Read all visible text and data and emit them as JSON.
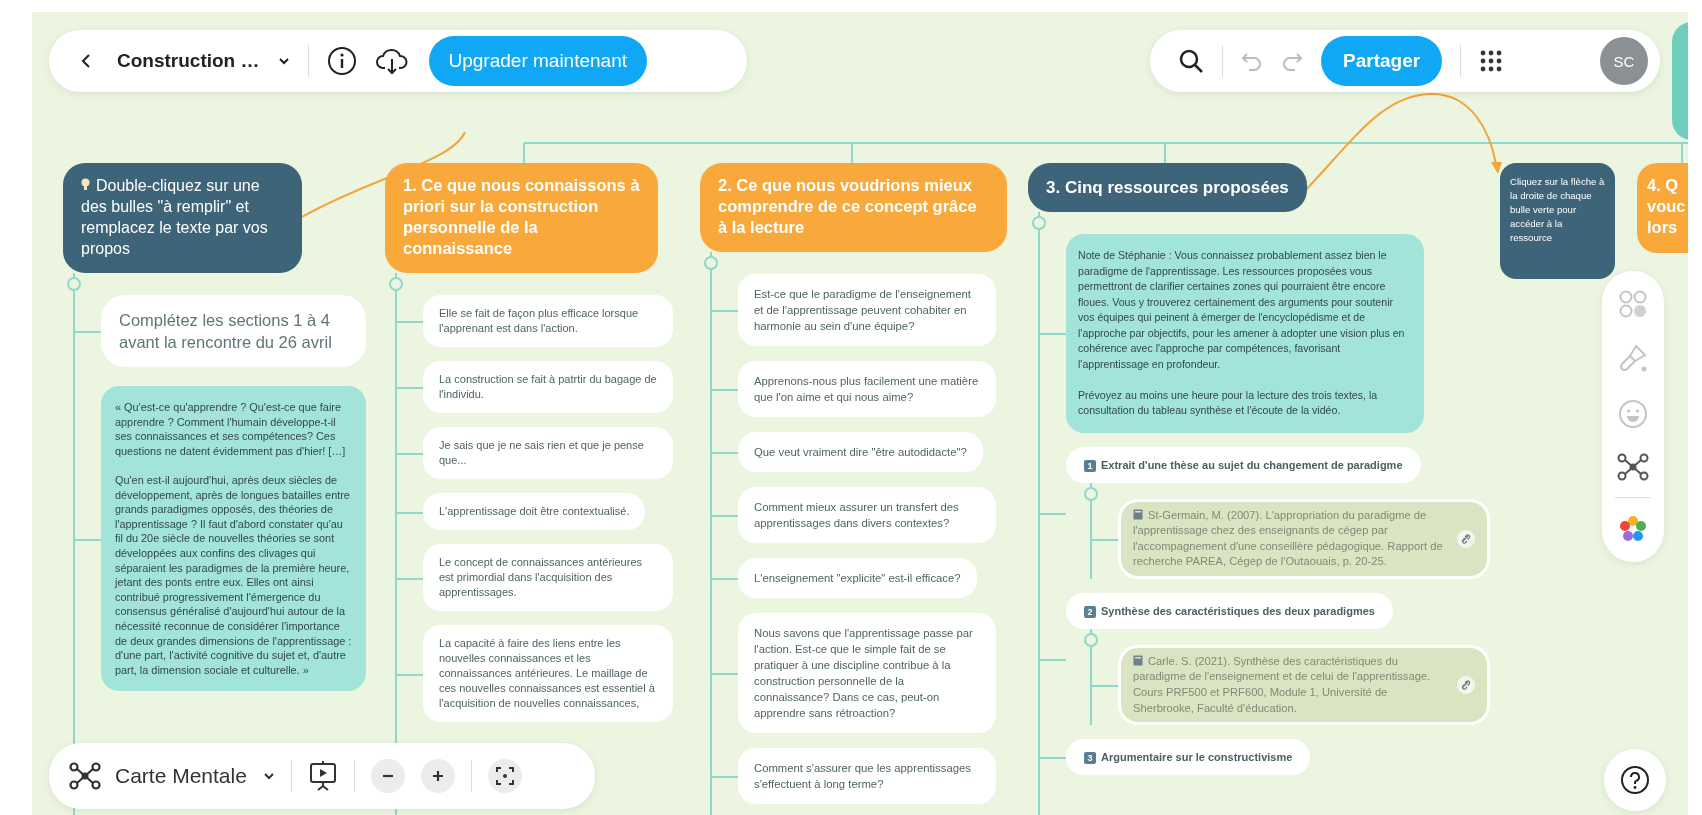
{
  "top_bar": {
    "title": "Construction …",
    "upgrade_button": "Upgrader maintenant",
    "share_button": "Partager",
    "avatar": "SC"
  },
  "columns": [
    {
      "header": {
        "text": "Double-cliquez sur une des bulles \"à remplir\" et remplacez le texte par vos propos",
        "color": "#3d6478"
      },
      "children": [
        {
          "kind": "label",
          "text": "Complétez les sections 1 à 4 avant la rencontre du 26 avril"
        },
        {
          "kind": "note",
          "text": "« Qu'est-ce qu'apprendre ? Qu'est-ce que faire apprendre ? Comment l'humain développe-t-il ses connaissances et ses compétences? Ces questions ne datent évidemment pas d'hier! […]\n\nQu'en est-il aujourd'hui, après deux siècles de développement, après de longues batailles entre grands paradigmes opposés, des théories de l'apprentissage ? Il faut d'abord constater qu'au fil du 20e siècle de nouvelles théories se sont développées aux confins des clivages qui séparaient les paradigmes de la première heure, jetant des ponts entre eux. Elles ont ainsi contribué progressivement l'émergence du consensus généralisé d'aujourd'hui autour de la nécessité reconnue de considérer l'importance de deux grandes dimensions de l'apprentissage : d'une part, l'activité cognitive du sujet et, d'autre part, la dimension sociale et culturelle. »"
        }
      ]
    },
    {
      "header": {
        "text": "1. Ce que nous connaissons à priori sur la construction personnelle de la connaissance",
        "color": "#f9a93b"
      },
      "children": [
        {
          "kind": "bubble",
          "text": "Elle se fait de façon plus efficace lorsque l'apprenant est dans l'action."
        },
        {
          "kind": "bubble",
          "text": "La construction se fait à patrtir du bagage de l'individu."
        },
        {
          "kind": "bubble",
          "text": "Je sais que je ne sais rien et que je pense que..."
        },
        {
          "kind": "bubble",
          "text": "L'apprentissage doit être contextualisé."
        },
        {
          "kind": "bubble",
          "text": "Le concept de connaissances antérieures est primordial dans l'acquisition des apprentissages."
        },
        {
          "kind": "bubble",
          "text": "La capacité à faire des liens entre les nouvelles connaissances et les connaissances antérieures.  Le maillage de ces nouvelles connaissances est essentiel à l'acquisition de nouvelles connaissances,"
        }
      ]
    },
    {
      "header": {
        "text": "2. Ce que nous voudrions mieux comprendre de ce concept grâce à la lecture",
        "color": "#f9a93b"
      },
      "children": [
        {
          "kind": "bubble",
          "text": "Est-ce que le paradigme de l'enseignement et de l'apprentissage peuvent cohabiter en harmonie au sein d'une équipe?"
        },
        {
          "kind": "bubble",
          "text": "Apprenons-nous plus facilement une matière que l'on aime et qui nous aime?"
        },
        {
          "kind": "bubble",
          "text": "Que veut vraiment dire \"être autodidacte\"?"
        },
        {
          "kind": "bubble",
          "text": "Comment mieux assurer un transfert des apprentissages dans divers contextes?"
        },
        {
          "kind": "bubble",
          "text": "L'enseignement \"explicite\" est-il efficace?"
        },
        {
          "kind": "bubble",
          "text": "Nous savons que l'apprentissage passe par l'action. Est-ce que le simple fait de se pratiquer à une discipline contribue à la construction personnelle de la connaissance?  Dans ce cas, peut-on apprendre sans rétroaction?"
        },
        {
          "kind": "bubble",
          "text": "Comment s'assurer que les apprentissages s'effectuent à long terme?"
        }
      ]
    },
    {
      "header": {
        "text": "3. Cinq ressources proposées",
        "color": "#3d6478"
      },
      "children": [
        {
          "kind": "note",
          "text": "Note de Stéphanie : Vous connaissez probablement assez bien le paradigme de l'apprentissage. Les ressources proposées vous permettront de clarifier certaines zones qui pourraient être encore floues. Vous y trouverez certainement des arguments pour soutenir vos équipes qui peinent à émerger de l'encyclopédisme et de l'approche par objectifs, pour les amener à adopter une vision plus en cohérence avec l'approche par compétences, favorisant l'apprentissage en profondeur.\n\nPrévoyez au moins une heure pour la lecture des trois textes, la consultation du tableau synthèse et l'écoute de la vidéo."
        },
        {
          "kind": "resource",
          "number": "1",
          "text": "Extrait d'une thèse au sujet du changement de paradigme",
          "children": [
            {
              "text": "St-Germain, M. (2007). L'appropriation du paradigme de l'apprentissage chez des enseignants de cégep par l'accompagnement d'une conseillère pédagogique. Rapport de recherche PAREA, Cégep de l'Outaouais, p. 20-25."
            }
          ]
        },
        {
          "kind": "resource",
          "number": "2",
          "text": "Synthèse des caractéristiques des deux paradigmes",
          "children": [
            {
              "text": "Carle. S. (2021). Synthèse des caractéristiques du paradigme de l'enseignement et de celui de l'apprentissage. Cours PRF500 et PRF600, Module 1, Université de Sherbrooke, Faculté d'éducation."
            }
          ]
        },
        {
          "kind": "resource",
          "number": "3",
          "text": "Argumentaire sur le constructivisme"
        }
      ]
    }
  ],
  "hint_note": "Cliquez sur la flèche à la droite de chaque bulle verte pour accéder à la ressource",
  "partial_header": {
    "text": "4. Q\nvouc\nlors",
    "color": "#f9a93b"
  },
  "bottom_bar": {
    "map_type": "Carte Mentale"
  }
}
